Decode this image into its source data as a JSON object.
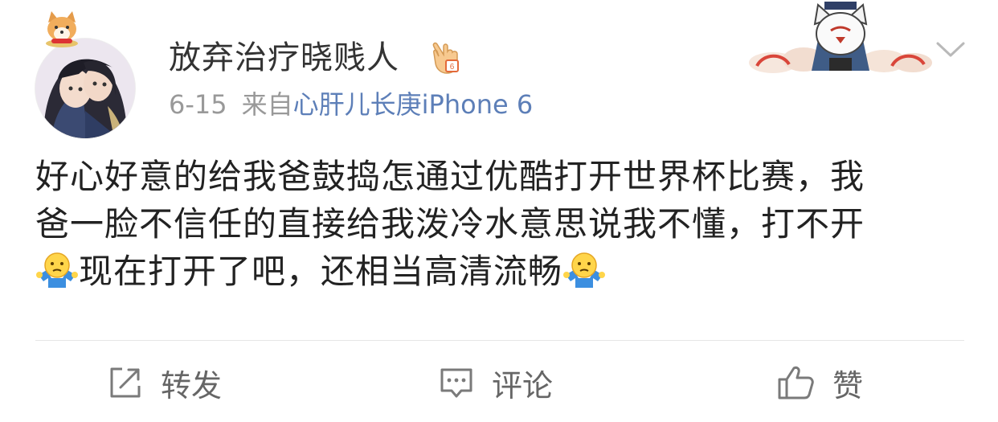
{
  "post": {
    "author": {
      "name": "放弃治疗晓贱人",
      "vip_icon": "shaka-hand-icon",
      "avatar": "anime-couple-avatar"
    },
    "meta": {
      "date": "6-15",
      "source_prefix": "来自",
      "device": "心肝儿长庚iPhone 6"
    },
    "text": {
      "line1": "好心好意的给我爸鼓捣怎通过优酷打开世界杯比赛，我",
      "line2": "爸一脸不信任的直接给我泼冷水意思说我不懂，打不开",
      "line3": "现在打开了吧，还相当高清流畅",
      "emoji": "shrug-emoji"
    },
    "actions": {
      "repost_label": "转发",
      "comment_label": "评论",
      "like_label": "赞"
    }
  },
  "colors": {
    "link": "#5d7fb8",
    "meta": "#999999",
    "action": "#666666",
    "text": "#222222"
  }
}
